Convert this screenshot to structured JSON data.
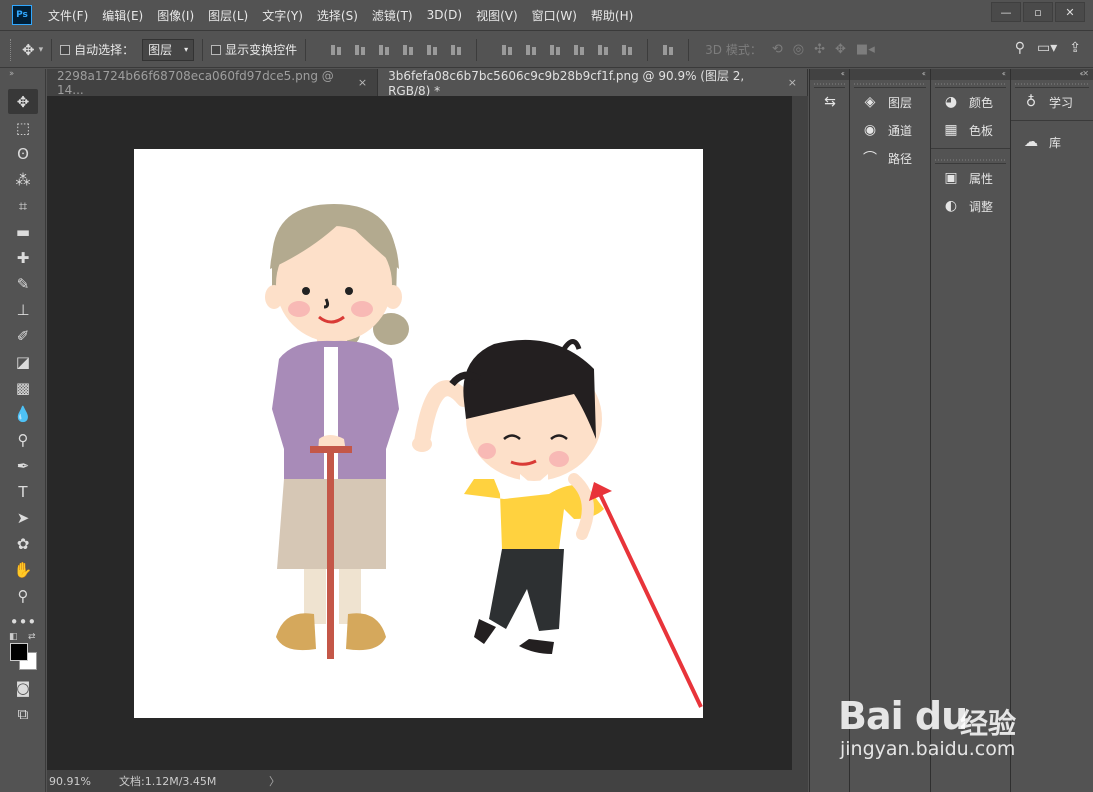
{
  "app": {
    "logo_text": "Ps"
  },
  "menu": [
    "文件(F)",
    "编辑(E)",
    "图像(I)",
    "图层(L)",
    "文字(Y)",
    "选择(S)",
    "滤镜(T)",
    "3D(D)",
    "视图(V)",
    "窗口(W)",
    "帮助(H)"
  ],
  "window_controls": {
    "minimize": "—",
    "restore": "▫",
    "close": "✕"
  },
  "options": {
    "auto_select_label": "自动选择：",
    "auto_select_value": "图层",
    "show_transform_label": "显示变换控件",
    "mode3d_label": "3D 模式："
  },
  "tabs": [
    {
      "label": "2298a1724b66f68708eca060fd97dce5.png @ 14...",
      "close": "×"
    },
    {
      "label": "3b6fefa08c6b7bc5606c9c9b28b9cf1f.png @ 90.9% (图层 2, RGB/8) *",
      "close": "×"
    }
  ],
  "status": {
    "zoom": "90.91%",
    "doc": "文档:1.12M/3.45M",
    "arrow": "〉"
  },
  "panels": {
    "col1": [
      {
        "icon": "history-icon",
        "glyph": "⇆"
      }
    ],
    "col2": [
      {
        "label": "图层",
        "glyph": "◈"
      },
      {
        "label": "通道",
        "glyph": "◉"
      },
      {
        "label": "路径",
        "glyph": "⌒"
      }
    ],
    "col3_top": [
      {
        "label": "颜色",
        "glyph": "◕"
      },
      {
        "label": "色板",
        "glyph": "▦"
      }
    ],
    "col3_bottom": [
      {
        "label": "属性",
        "glyph": "▣"
      },
      {
        "label": "调整",
        "glyph": "◐"
      }
    ],
    "col4": [
      {
        "label": "学习",
        "glyph": "♁"
      },
      {
        "label": "库",
        "glyph": "☁"
      }
    ]
  },
  "watermark": {
    "brand": "Bai du",
    "cn": "经验",
    "url": "jingyan.baidu.com"
  },
  "colors": {
    "accent": "#31a8ff",
    "arrow": "#e8343a"
  }
}
